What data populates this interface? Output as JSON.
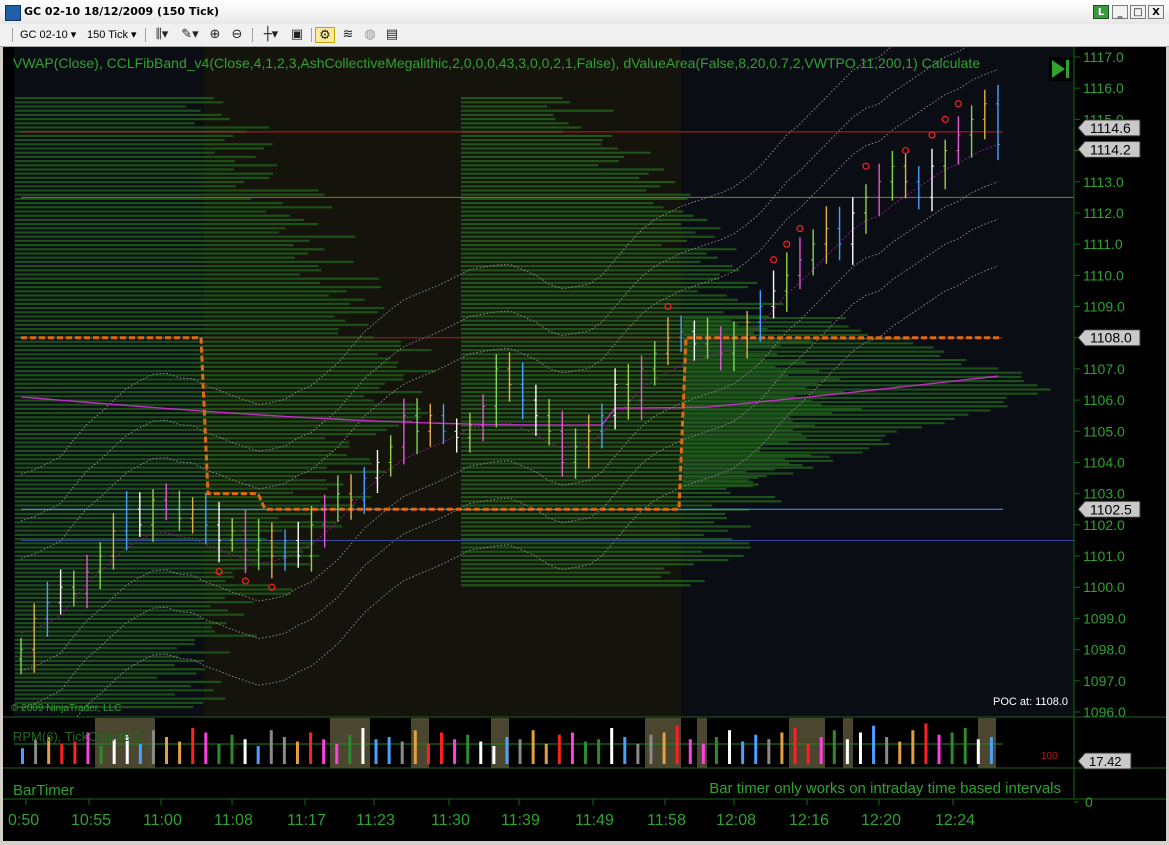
{
  "window": {
    "title": "GC 02-10  18/12/2009 (150 Tick)",
    "indicator_letter": "L",
    "minimize": "_",
    "maximize": "□",
    "close": "X"
  },
  "toolbar": {
    "instrument": "GC 02-10",
    "period": "150 Tick"
  },
  "chart_data": [
    {
      "type": "candlestick",
      "indicator_text": "VWAP(Close),  CCLFibBand_v4(Close,4,1,2,3,AshCollectiveMegalithic,2,0,0,0,43,3,0,0,2,1,False),  dValueArea(False,8,20,0.7,2,VWTPO,11,200,1)  Calculate",
      "copyright": "© 2009 NinjaTrader, LLC",
      "poc_label": "POC at:  1108.0",
      "ylim": [
        1096.0,
        1117.0
      ],
      "y_ticks": [
        1096.0,
        1097.0,
        1098.0,
        1099.0,
        1100.0,
        1101.0,
        1102.0,
        1103.0,
        1104.0,
        1105.0,
        1106.0,
        1107.0,
        1108.0,
        1109.0,
        1110.0,
        1111.0,
        1112.0,
        1113.0,
        1114.0,
        1115.0,
        1116.0,
        1117.0
      ],
      "y_tick_labels": [
        "1096.0",
        "1097.0",
        "1098.0",
        "1099.0",
        "1100.0",
        "1101.0",
        "1102.0",
        "1103.0",
        "1104.0",
        "1105.0",
        "1106.0",
        "1107.0",
        "1108.0",
        "1109.0",
        "1110.0",
        "1111.0",
        "1112.0",
        "1113.0",
        "1114.0",
        "1115.0",
        "1116.0",
        "1117.0"
      ],
      "price_markers": [
        {
          "label": "1114.6",
          "value": 1114.6
        },
        {
          "label": "1114.2",
          "value": 1114.2
        },
        {
          "label": "1108.0",
          "value": 1108.0
        },
        {
          "label": "1102.5",
          "value": 1102.5
        }
      ],
      "levels": [
        {
          "value": 1114.6,
          "color": "#c81818"
        },
        {
          "value": 1112.5,
          "color": "#8a7a1a"
        },
        {
          "value": 1108.0,
          "color": "#b01818"
        },
        {
          "value": 1102.5,
          "color": "#4aa0ff"
        },
        {
          "value": 1101.5,
          "color": "#3a4aa0"
        }
      ],
      "x_labels": [
        "0:50",
        "10:55",
        "11:00",
        "11:08",
        "11:17",
        "11:23",
        "11:30",
        "11:39",
        "11:49",
        "11:58",
        "12:08",
        "12:16",
        "12:20",
        "12:24"
      ],
      "closes": [
        1098.0,
        1099.0,
        1099.5,
        1100.0,
        1099.8,
        1100.5,
        1101.0,
        1101.8,
        1102.5,
        1102.0,
        1102.8,
        1102.5,
        1102.2,
        1102.5,
        1102.0,
        1101.5,
        1101.8,
        1101.2,
        1101.5,
        1101.0,
        1101.5,
        1101.0,
        1102.0,
        1102.5,
        1103.0,
        1102.8,
        1103.5,
        1104.0,
        1104.5,
        1105.5,
        1105.0,
        1105.5,
        1105.0,
        1104.8,
        1105.2,
        1105.8,
        1107.0,
        1106.5,
        1106.0,
        1105.5,
        1105.0,
        1104.0,
        1104.5,
        1105.0,
        1105.5,
        1106.5,
        1106.0,
        1107.0,
        1107.5,
        1108.0,
        1108.2,
        1107.8,
        1108.0,
        1107.5,
        1108.0,
        1108.5,
        1109.0,
        1109.5,
        1110.0,
        1110.5,
        1111.0,
        1111.5,
        1111.0,
        1112.0,
        1112.5,
        1113.0,
        1113.5,
        1113.0,
        1112.5,
        1113.5,
        1114.0,
        1114.5,
        1115.0,
        1115.5,
        1114.2
      ],
      "vwap_start": 1105.8,
      "vwap_end": 1105.8,
      "value_area_high_path": [
        1108.0,
        1108.0,
        1103.0,
        1103.0,
        1102.5,
        1102.5,
        1108.0,
        1108.0
      ]
    },
    {
      "type": "bar",
      "title": "RPM(6), TickCounter2",
      "ylim": [
        0,
        100
      ],
      "y_label": "100",
      "value_marker": "17.42",
      "values": [
        35,
        55,
        60,
        45,
        50,
        70,
        40,
        55,
        65,
        45,
        75,
        60,
        50,
        80,
        70,
        45,
        65,
        55,
        40,
        75,
        60,
        50,
        70,
        55,
        45,
        65,
        80,
        55,
        60,
        50,
        75,
        45,
        70,
        55,
        65,
        50,
        40,
        60,
        55,
        75,
        45,
        65,
        70,
        50,
        55,
        80,
        60,
        45,
        65,
        70,
        85,
        55,
        45,
        60,
        75,
        50,
        65,
        55,
        70,
        80,
        45,
        60,
        75,
        55,
        70,
        85,
        60,
        50,
        75,
        90,
        65,
        70,
        80,
        55,
        60
      ]
    },
    {
      "type": "text",
      "title": "BarTimer",
      "message": "Bar timer only works on intraday time based intervals",
      "y_tick": "0"
    }
  ]
}
